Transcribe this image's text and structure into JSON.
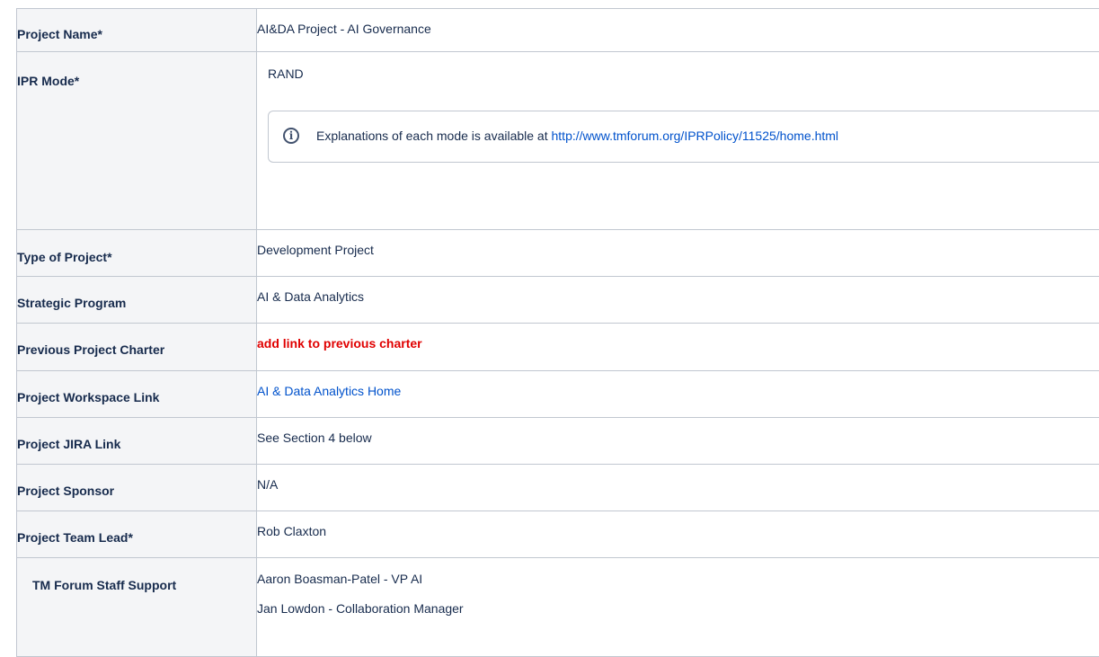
{
  "rows": {
    "project_name": {
      "label": "Project Name*",
      "value": "AI&DA Project - AI Governance"
    },
    "ipr_mode": {
      "label": "IPR Mode*",
      "value": "RAND",
      "info_text": "Explanations of each mode is available at ",
      "info_link": "http://www.tmforum.org/IPRPolicy/11525/home.html"
    },
    "type_of_project": {
      "label": "Type of Project*",
      "value": "Development Project"
    },
    "strategic_program": {
      "label": "Strategic Program",
      "value": "AI & Data Analytics"
    },
    "previous_charter": {
      "label": "Previous Project Charter",
      "value": "add link to previous charter"
    },
    "workspace_link": {
      "label": "Project Workspace Link",
      "value": "AI & Data Analytics Home"
    },
    "jira_link": {
      "label": "Project JIRA Link",
      "value": "See Section 4 below"
    },
    "sponsor": {
      "label": "Project Sponsor",
      "value": "N/A"
    },
    "team_lead": {
      "label": "Project Team Lead*",
      "value": "Rob Claxton"
    },
    "staff_support": {
      "label": "TM Forum Staff Support",
      "values": [
        "Aaron Boasman-Patel - VP AI",
        "Jan Lowdon - Collaboration Manager"
      ]
    }
  },
  "icons": {
    "info": "info-circle-icon"
  },
  "colors": {
    "link": "#0052cc",
    "alert": "#e00000",
    "header_bg": "#f4f5f7"
  }
}
